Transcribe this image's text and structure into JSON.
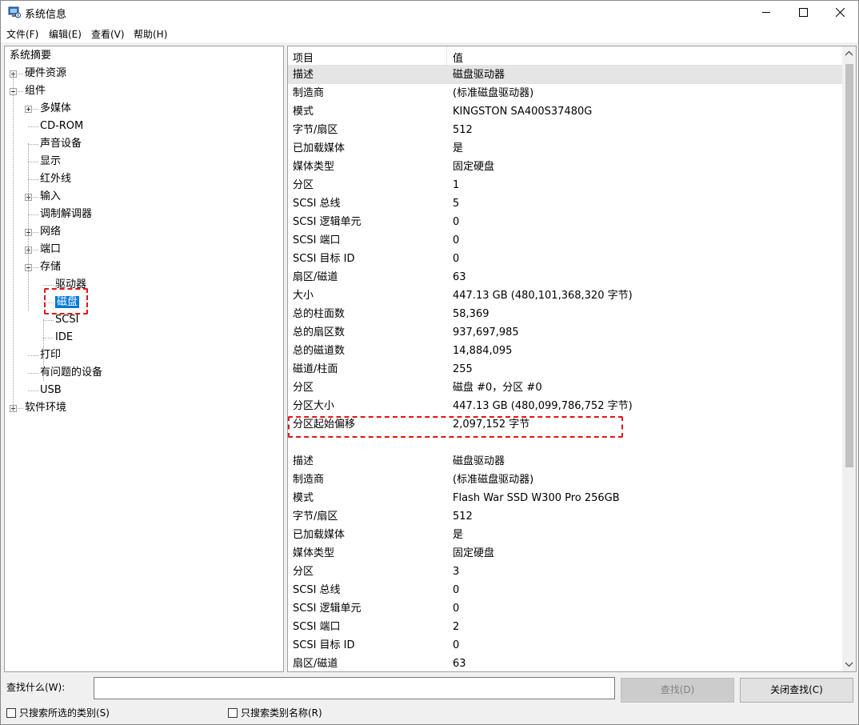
{
  "window": {
    "title": "系统信息",
    "controls": {
      "minimize": "—",
      "maximize": "☐",
      "close": "✕"
    }
  },
  "menu": [
    "文件(F)",
    "编辑(E)",
    "查看(V)",
    "帮助(H)"
  ],
  "tree": [
    {
      "label": "系统摘要",
      "level": 0,
      "toggle": "none"
    },
    {
      "label": "硬件资源",
      "level": 1,
      "toggle": "plus"
    },
    {
      "label": "组件",
      "level": 1,
      "toggle": "minus"
    },
    {
      "label": "多媒体",
      "level": 2,
      "toggle": "plus"
    },
    {
      "label": "CD-ROM",
      "level": 2,
      "toggle": "none"
    },
    {
      "label": "声音设备",
      "level": 2,
      "toggle": "none"
    },
    {
      "label": "显示",
      "level": 2,
      "toggle": "none"
    },
    {
      "label": "红外线",
      "level": 2,
      "toggle": "none"
    },
    {
      "label": "输入",
      "level": 2,
      "toggle": "plus"
    },
    {
      "label": "调制解调器",
      "level": 2,
      "toggle": "none"
    },
    {
      "label": "网络",
      "level": 2,
      "toggle": "plus"
    },
    {
      "label": "端口",
      "level": 2,
      "toggle": "plus"
    },
    {
      "label": "存储",
      "level": 2,
      "toggle": "minus"
    },
    {
      "label": "驱动器",
      "level": 3,
      "toggle": "none"
    },
    {
      "label": "磁盘",
      "level": 3,
      "toggle": "none",
      "selected": true
    },
    {
      "label": "SCSI",
      "level": 3,
      "toggle": "none"
    },
    {
      "label": "IDE",
      "level": 3,
      "toggle": "none"
    },
    {
      "label": "打印",
      "level": 2,
      "toggle": "none"
    },
    {
      "label": "有问题的设备",
      "level": 2,
      "toggle": "none"
    },
    {
      "label": "USB",
      "level": 2,
      "toggle": "none"
    },
    {
      "label": "软件环境",
      "level": 1,
      "toggle": "plus"
    }
  ],
  "list": {
    "header": {
      "item": "项目",
      "value": "值"
    },
    "rows": [
      {
        "k": "描述",
        "v": "磁盘驱动器",
        "selected": true
      },
      {
        "k": "制造商",
        "v": "(标准磁盘驱动器)"
      },
      {
        "k": "模式",
        "v": "KINGSTON SA400S37480G"
      },
      {
        "k": "字节/扇区",
        "v": "512"
      },
      {
        "k": "已加载媒体",
        "v": "是"
      },
      {
        "k": "媒体类型",
        "v": "固定硬盘"
      },
      {
        "k": "分区",
        "v": "1"
      },
      {
        "k": "SCSI 总线",
        "v": "5"
      },
      {
        "k": "SCSI 逻辑单元",
        "v": "0"
      },
      {
        "k": "SCSI 端口",
        "v": "0"
      },
      {
        "k": "SCSI 目标 ID",
        "v": "0"
      },
      {
        "k": "扇区/磁道",
        "v": "63"
      },
      {
        "k": "大小",
        "v": "447.13 GB (480,101,368,320 字节)"
      },
      {
        "k": "总的柱面数",
        "v": "58,369"
      },
      {
        "k": "总的扇区数",
        "v": "937,697,985"
      },
      {
        "k": "总的磁道数",
        "v": "14,884,095"
      },
      {
        "k": "磁道/柱面",
        "v": "255"
      },
      {
        "k": "分区",
        "v": "磁盘 #0，分区 #0"
      },
      {
        "k": "分区大小",
        "v": "447.13 GB (480,099,786,752 字节)"
      },
      {
        "k": "分区起始偏移",
        "v": "2,097,152 字节",
        "highlight": true
      },
      {
        "k": "",
        "v": ""
      },
      {
        "k": "描述",
        "v": "磁盘驱动器"
      },
      {
        "k": "制造商",
        "v": "(标准磁盘驱动器)"
      },
      {
        "k": "模式",
        "v": "Flash War SSD W300 Pro 256GB"
      },
      {
        "k": "字节/扇区",
        "v": "512"
      },
      {
        "k": "已加载媒体",
        "v": "是"
      },
      {
        "k": "媒体类型",
        "v": "固定硬盘"
      },
      {
        "k": "分区",
        "v": "3"
      },
      {
        "k": "SCSI 总线",
        "v": "0"
      },
      {
        "k": "SCSI 逻辑单元",
        "v": "0"
      },
      {
        "k": "SCSI 端口",
        "v": "2"
      },
      {
        "k": "SCSI 目标 ID",
        "v": "0"
      },
      {
        "k": "扇区/磁道",
        "v": "63"
      }
    ]
  },
  "find": {
    "label": "查找什么(W):",
    "value": "",
    "find_button": "查找(D)",
    "close_button": "关闭查找(C)",
    "option_selected": "只搜索所选的类别(S)",
    "option_names": "只搜索类别名称(R)"
  },
  "colors": {
    "selection": "#0078d7",
    "highlight_box": "#e0151b"
  }
}
